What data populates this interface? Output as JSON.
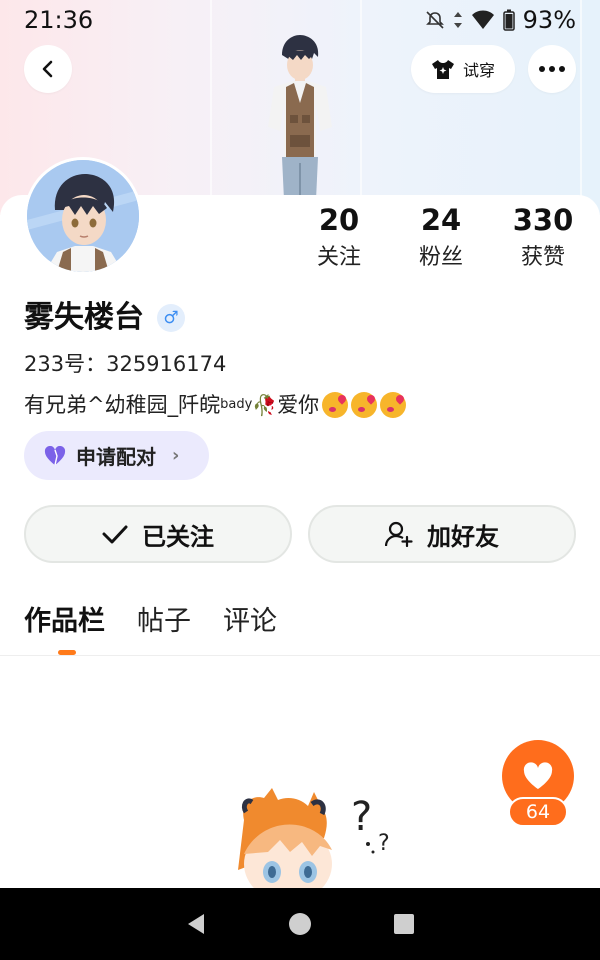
{
  "status_bar": {
    "time": "21:36",
    "battery": "93%"
  },
  "header": {
    "tryon_label": "试穿"
  },
  "stats": [
    {
      "num": "20",
      "label": "关注"
    },
    {
      "num": "24",
      "label": "粉丝"
    },
    {
      "num": "330",
      "label": "获赞"
    }
  ],
  "profile": {
    "name": "雾失楼台",
    "gender_symbol": "♂",
    "uid_label": "233号：",
    "uid_value": "325916174",
    "bio_text": "有兄弟^幼稚园_阡皖",
    "bio_sup": "bady",
    "bio_rose": "🥀",
    "bio_love": "爱你"
  },
  "pair_pill": {
    "label": "申请配对"
  },
  "actions": {
    "follow_label": "已关注",
    "add_friend_label": "加好友"
  },
  "tabs": [
    {
      "label": "作品栏",
      "active": true
    },
    {
      "label": "帖子",
      "active": false
    },
    {
      "label": "评论",
      "active": false
    }
  ],
  "like": {
    "count": "64"
  },
  "colors": {
    "accent": "#ff6d1c",
    "pill_bg": "#ebeafd",
    "gender": "#3d8ef2"
  }
}
